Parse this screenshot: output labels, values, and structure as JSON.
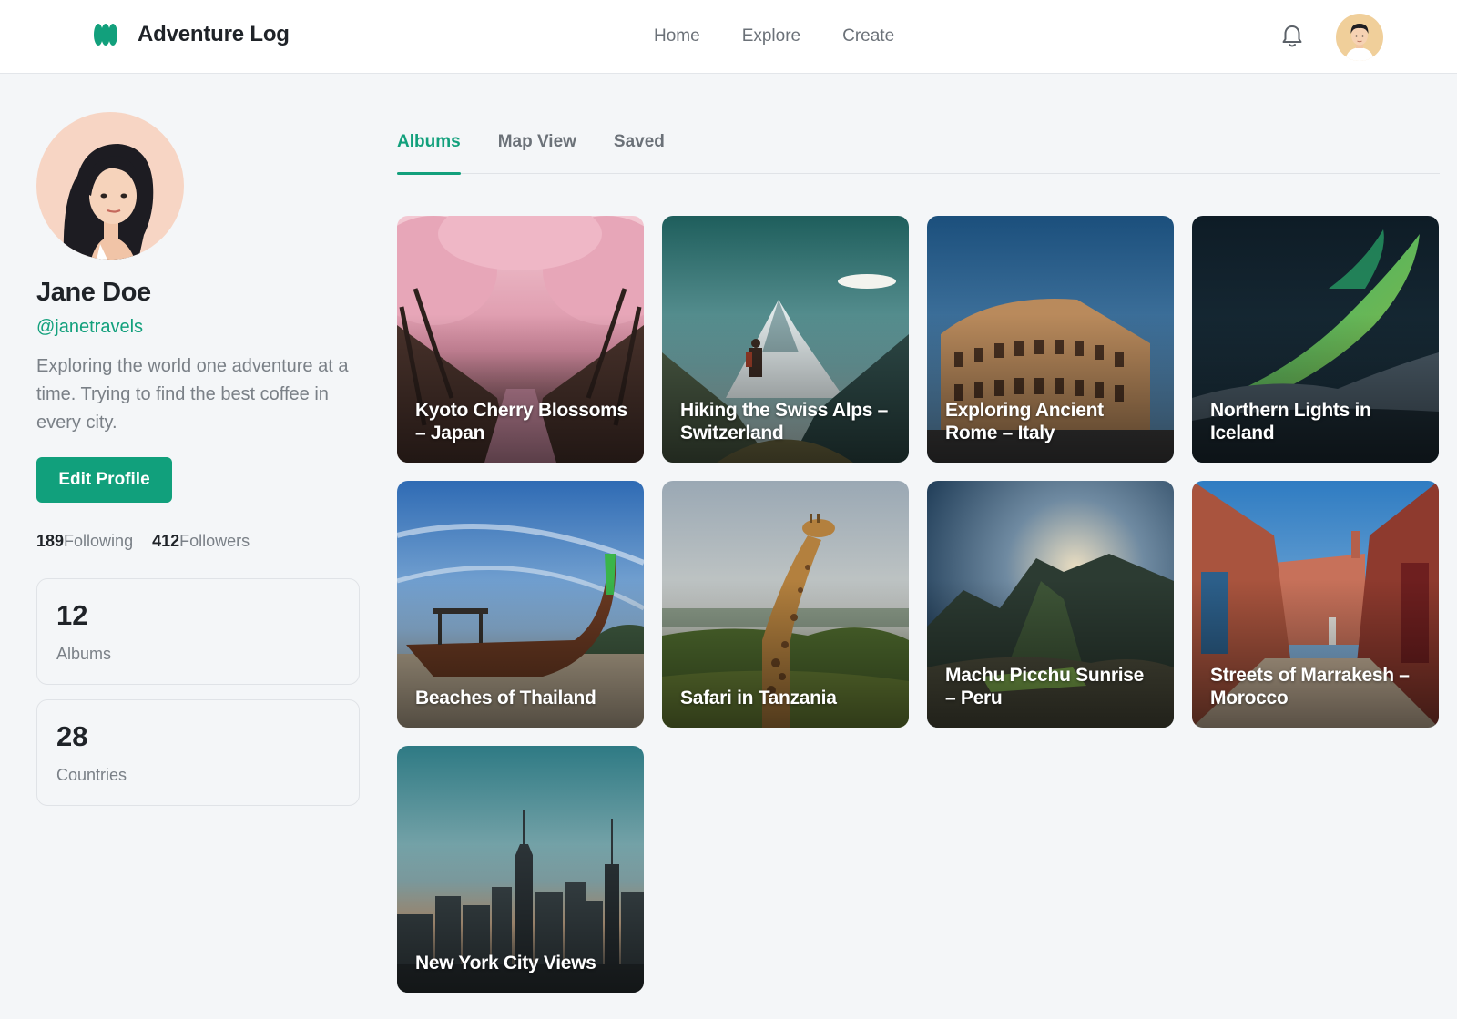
{
  "app": {
    "name": "Adventure Log",
    "logo_icon": "brand-logo-icon",
    "accent_color": "#11a07c"
  },
  "nav": {
    "home": "Home",
    "explore": "Explore",
    "create": "Create"
  },
  "header_icons": {
    "notifications": "bell-icon",
    "account": "user-avatar"
  },
  "profile": {
    "name": "Jane Doe",
    "handle": "@janetravels",
    "bio": "Exploring the world one adventure at a time. Trying to find the best coffee in every city.",
    "edit_label": "Edit Profile",
    "following_count": "189",
    "following_label": "Following",
    "followers_count": "412",
    "followers_label": "Followers"
  },
  "stats": [
    {
      "value": "12",
      "label": "Albums"
    },
    {
      "value": "28",
      "label": "Countries"
    }
  ],
  "tabs": [
    {
      "label": "Albums",
      "active": true
    },
    {
      "label": "Map View",
      "active": false
    },
    {
      "label": "Saved",
      "active": false
    }
  ],
  "albums": [
    {
      "title": "Kyoto Cherry Blossoms – Japan"
    },
    {
      "title": "Hiking the Swiss Alps – Switzerland"
    },
    {
      "title": "Exploring Ancient Rome – Italy"
    },
    {
      "title": "Northern Lights in Iceland"
    },
    {
      "title": "Beaches of Thailand"
    },
    {
      "title": "Safari in Tanzania"
    },
    {
      "title": "Machu Picchu Sunrise – Peru"
    },
    {
      "title": "Streets of Marrakesh – Morocco"
    },
    {
      "title": "New York City Views"
    }
  ]
}
